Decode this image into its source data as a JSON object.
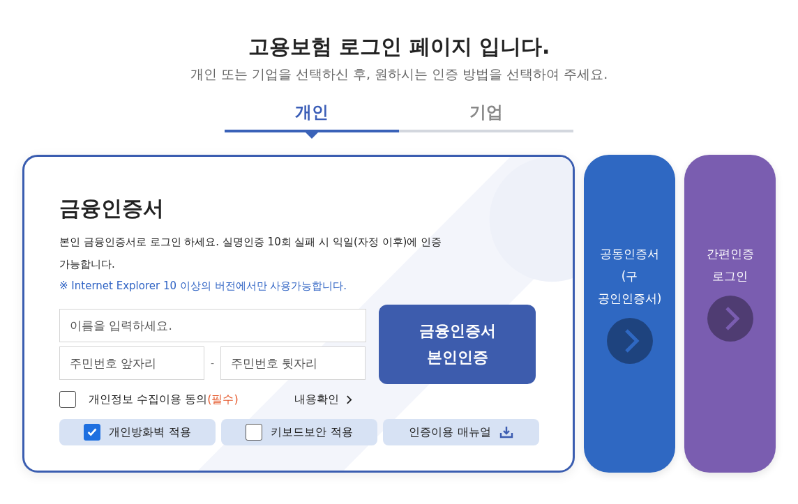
{
  "header": {
    "title": "고용보험 로그인 페이지 입니다.",
    "subtitle": "개인 또는 기업을 선택하신 후, 원하시는 인증 방법을 선택하여 주세요."
  },
  "tabs": [
    {
      "label": "개인",
      "selected": true
    },
    {
      "label": "기업",
      "selected": false
    }
  ],
  "main_card": {
    "title": "금융인증서",
    "description": "본인 금융인증서로 로그인 하세요. 실명인증 10회 실패 시 익일(자정 이후)에 인증가능합니다.",
    "notice": "※ Internet Explorer 10 이상의 버전에서만 사용가능합니다.",
    "name_field": {
      "placeholder": "이름을 입력하세요."
    },
    "rrn_front": {
      "placeholder": "주민번호 앞자리"
    },
    "separator": "-",
    "rrn_back": {
      "placeholder": "주민번호 뒷자리"
    },
    "submit_button": {
      "lines": [
        "금융인증서",
        "본인인증"
      ]
    },
    "consent": {
      "label": "개인정보 수집이용 동의",
      "required": "(필수)",
      "checked": false,
      "link": "내용확인"
    },
    "options": [
      {
        "kind": "checkbox",
        "label": "개인방화벽 적용",
        "checked": true
      },
      {
        "kind": "checkbox",
        "label": "키보드보안 적용",
        "checked": false
      },
      {
        "kind": "link",
        "label": "인증이용 매뉴얼"
      }
    ]
  },
  "side_cards": [
    {
      "lines": [
        "공동인증서",
        "(구",
        "공인인증서)"
      ],
      "color": "#2f68c2"
    },
    {
      "lines": [
        "간편인증",
        "로그인"
      ],
      "color": "#7a5db0"
    }
  ]
}
